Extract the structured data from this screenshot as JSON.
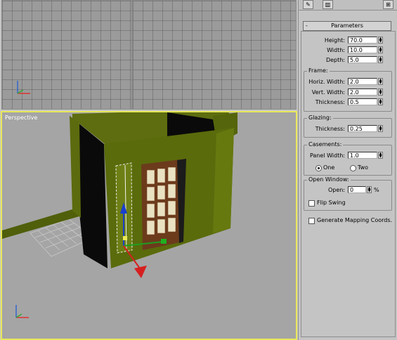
{
  "viewports": {
    "perspective_label": "Perspective"
  },
  "panel": {
    "parameters_title": "Parameters",
    "collapse_symbol": "-",
    "height_label": "Height:",
    "height_value": "70.0",
    "width_label": "Width:",
    "width_value": "10.0",
    "depth_label": "Depth:",
    "depth_value": "5.0",
    "frame": {
      "title": "Frame:",
      "horiz_width_label": "Horiz. Width:",
      "horiz_width_value": "2.0",
      "vert_width_label": "Vert. Width:",
      "vert_width_value": "2.0",
      "thickness_label": "Thickness:",
      "thickness_value": "0.5"
    },
    "glazing": {
      "title": "Glazing:",
      "thickness_label": "Thickness:",
      "thickness_value": "0.25"
    },
    "casements": {
      "title": "Casements:",
      "panel_width_label": "Panel Width:",
      "panel_width_value": "1.0",
      "one_label": "One",
      "two_label": "Two",
      "selected": "One"
    },
    "open_window": {
      "title": "Open Window:",
      "open_label": "Open:",
      "open_value": "0",
      "percent_symbol": "%",
      "flip_swing_label": "Flip Swing",
      "flip_swing_checked": false
    },
    "generate_mapping_label": "Generate Mapping Coords.",
    "generate_mapping_checked": false
  },
  "colors": {
    "active_viewport_border": "#e8e85a",
    "wall": "#5a6b0c",
    "frame_wood": "#6b3b1c",
    "glass": "#e9e2c2"
  }
}
